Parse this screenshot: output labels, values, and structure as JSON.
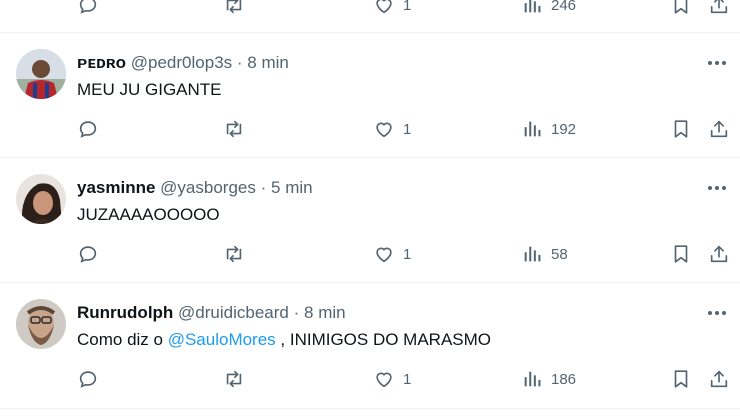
{
  "feed": {
    "top_partial": {
      "likes": "1",
      "views": "246"
    },
    "tweets": [
      {
        "display_name": "ᴘᴇᴅʀᴏ",
        "handle": "@pedr0lop3s",
        "separator": "·",
        "time": "8 min",
        "text": "MEU JU GIGANTE",
        "likes": "1",
        "views": "192"
      },
      {
        "display_name": "yasminne",
        "handle": "@yasborges",
        "separator": "·",
        "time": "5 min",
        "text": "JUZAAAAOOOOO",
        "likes": "1",
        "views": "58"
      },
      {
        "display_name": "Runrudolph",
        "handle": "@druidicbeard",
        "separator": "·",
        "time": "8 min",
        "text_before": "Como diz o ",
        "mention": "@SauloMores",
        "text_after": " , INIMIGOS DO MARASMO",
        "likes": "1",
        "views": "186"
      }
    ]
  },
  "icons": {
    "reply": "reply-icon",
    "retweet": "retweet-icon",
    "like": "heart-icon",
    "views": "views-icon",
    "bookmark": "bookmark-icon",
    "share": "share-icon",
    "more": "more-icon"
  },
  "colors": {
    "text": "#0f1419",
    "muted": "#536471",
    "link": "#1d9bf0",
    "divider": "#eff3f4"
  }
}
